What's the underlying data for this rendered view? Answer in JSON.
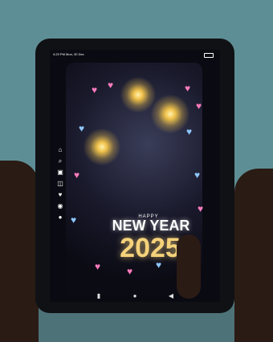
{
  "status_time": "4:23 PM Mon, 30 Dec",
  "message": {
    "happy": "HAPPY",
    "new_year": "NEW YEAR",
    "year": "2025"
  },
  "colors": {
    "wall": "#5e8e95",
    "tablet": "#101114",
    "screen_bg": "#0a0a12",
    "gold": "#f5d27a",
    "pink": "#ff7bbd",
    "blue": "#8ec7ff"
  }
}
